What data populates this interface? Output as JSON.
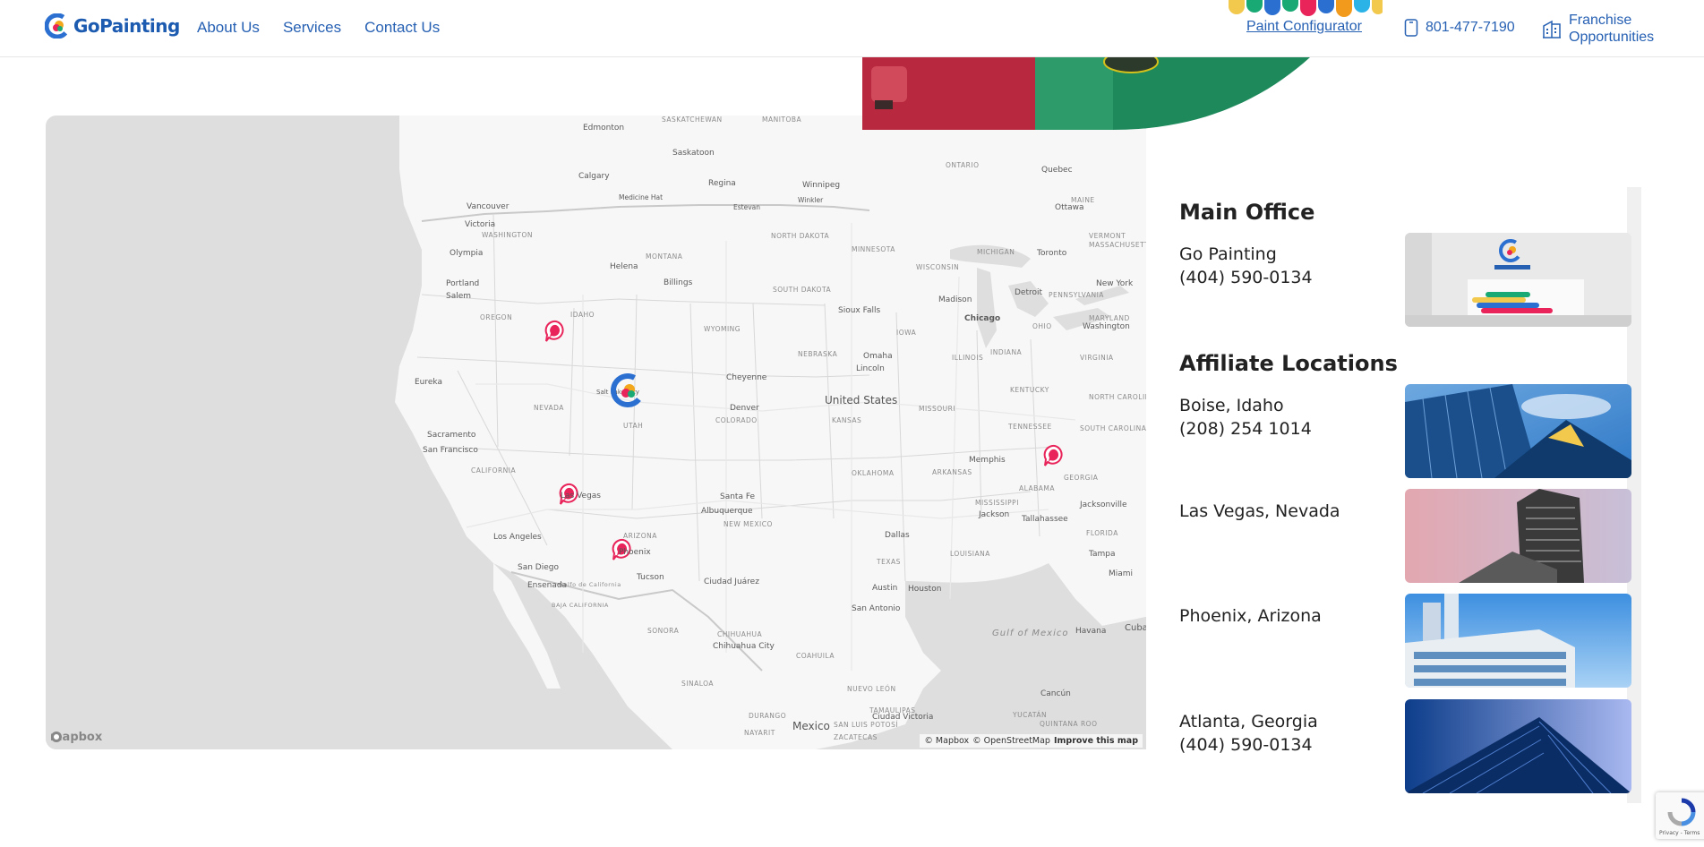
{
  "header": {
    "brand": "GoPainting",
    "nav": [
      {
        "label": "About Us"
      },
      {
        "label": "Services"
      },
      {
        "label": "Contact Us"
      }
    ],
    "paint_configurator": "Paint Configurator",
    "phone": "801-477-7190",
    "franchise": [
      "Franchise",
      "Opportunities"
    ]
  },
  "map": {
    "country_label": "United States",
    "labels": {
      "edmonton": "Edmonton",
      "saskatoon": "Saskatoon",
      "calgary": "Calgary",
      "regina": "Regina",
      "winnipeg": "Winnipeg",
      "vancouver": "Vancouver",
      "victoria": "Victoria",
      "medicine_hat": "Medicine Hat",
      "estevan": "Estevan",
      "winkler": "Winkler",
      "quebec": "Quebec",
      "ottawa": "Ottawa",
      "toronto": "Toronto",
      "new_york": "New York",
      "washington": "Washington",
      "olympia": "Olympia",
      "portland": "Portland",
      "salem": "Salem",
      "helena": "Helena",
      "billings": "Billings",
      "eureka": "Eureka",
      "sacramento": "Sacramento",
      "san_francisco": "San Francisco",
      "los_angeles": "Los Angeles",
      "san_diego": "San Diego",
      "ensenada": "Ensenada",
      "tucson": "Tucson",
      "ciudad_juarez": "Ciudad Juárez",
      "santa_fe": "Santa Fe",
      "albuquerque": "Albuquerque",
      "denver": "Denver",
      "cheyenne": "Cheyenne",
      "sioux_falls": "Sioux Falls",
      "omaha": "Omaha",
      "lincoln": "Lincoln",
      "madison": "Madison",
      "chicago": "Chicago",
      "detroit": "Detroit",
      "memphis": "Memphis",
      "jackson": "Jackson",
      "dallas": "Dallas",
      "austin": "Austin",
      "houston": "Houston",
      "san_antonio": "San Antonio",
      "tallahassee": "Tallahassee",
      "jacksonville": "Jacksonville",
      "tampa": "Tampa",
      "miami": "Miami",
      "havana": "Havana",
      "cuba": "Cuba",
      "cancun": "Cancún",
      "mexico": "Mexico",
      "chihuahua": "Chihuahua City",
      "ciudad_victoria": "Ciudad Victoria",
      "salt_lake": "Salt Lake City",
      "las_vegas": "Las Vegas",
      "phoenix": "Phoenix",
      "s_washington": "WASHINGTON",
      "s_montana": "MONTANA",
      "s_north_dakota": "NORTH DAKOTA",
      "s_south_dakota": "SOUTH DAKOTA",
      "s_minnesota": "MINNESOTA",
      "s_wisconsin": "WISCONSIN",
      "s_michigan": "MICHIGAN",
      "s_oregon": "OREGON",
      "s_idaho": "IDAHO",
      "s_wyoming": "WYOMING",
      "s_nebraska": "NEBRASKA",
      "s_iowa": "IOWA",
      "s_illinois": "ILLINOIS",
      "s_indiana": "INDIANA",
      "s_ohio": "OHIO",
      "s_pennsylvania": "PENNSYLVANIA",
      "s_nevada": "NEVADA",
      "s_utah": "UTAH",
      "s_colorado": "COLORADO",
      "s_kansas": "KANSAS",
      "s_missouri": "MISSOURI",
      "s_kentucky": "KENTUCKY",
      "s_virginia": "VIRGINIA",
      "s_north_carolina": "NORTH CAROLINA",
      "s_tennessee": "TENNESSEE",
      "s_south_carolina": "SOUTH CAROLINA",
      "s_california": "CALIFORNIA",
      "s_arizona": "ARIZONA",
      "s_new_mexico": "NEW MEXICO",
      "s_oklahoma": "OKLAHOMA",
      "s_arkansas": "ARKANSAS",
      "s_mississippi": "MISSISSIPPI",
      "s_alabama": "ALABAMA",
      "s_georgia": "GEORGIA",
      "s_texas": "TEXAS",
      "s_louisiana": "LOUISIANA",
      "s_florida": "FLORIDA",
      "s_sonora": "SONORA",
      "s_chihuahua": "CHIHUAHUA",
      "s_coahuila": "COAHUILA",
      "s_nuevo_leon": "NUEVO LEÓN",
      "s_durango": "DURANGO",
      "s_saskatchewan": "SASKATCHEWAN",
      "s_manitoba": "MANITOBA",
      "s_ontario": "ONTARIO",
      "s_baja": "BAJA CALIFORNIA",
      "s_maine": "MAINE",
      "s_vermont": "VERMONT",
      "s_massachusetts": "MASSACHUSETTS",
      "s_maryland": "MARYLAND",
      "s_yucatan": "YUCATÁN",
      "s_quintana": "QUINTANA ROO",
      "s_tamaulipas": "TAMAULIPAS",
      "s_sinaloa": "SINALOA",
      "s_zacatecas": "ZACATECAS",
      "s_san_luis": "SAN LUIS POTOSÍ",
      "s_nayarit": "NAYARIT",
      "golfo_california": "Golfo de California",
      "gulf_mexico": "Gulf of Mexico"
    },
    "mapbox_logo": "mapbox",
    "attribution": {
      "mapbox": "© Mapbox",
      "osm": "© OpenStreetMap",
      "improve": "Improve this map"
    }
  },
  "locations": {
    "main_title": "Main Office",
    "main_office": {
      "name": "Go Painting",
      "phone": "(404) 590-0134"
    },
    "affiliate_title": "Affiliate Locations",
    "affiliates": [
      {
        "city": "Boise, Idaho",
        "phone": "(208) 254 1014"
      },
      {
        "city": "Las Vegas, Nevada",
        "phone": ""
      },
      {
        "city": "Phoenix, Arizona",
        "phone": ""
      },
      {
        "city": "Atlanta, Georgia",
        "phone": "(404) 590-0134"
      }
    ]
  },
  "recaptcha": {
    "text": "Privacy - Terms"
  },
  "colors": {
    "brand_blue": "#2660b3",
    "pin_red": "#e8245a",
    "map_land": "#f5f5f5",
    "map_water": "#dcdcdc"
  }
}
